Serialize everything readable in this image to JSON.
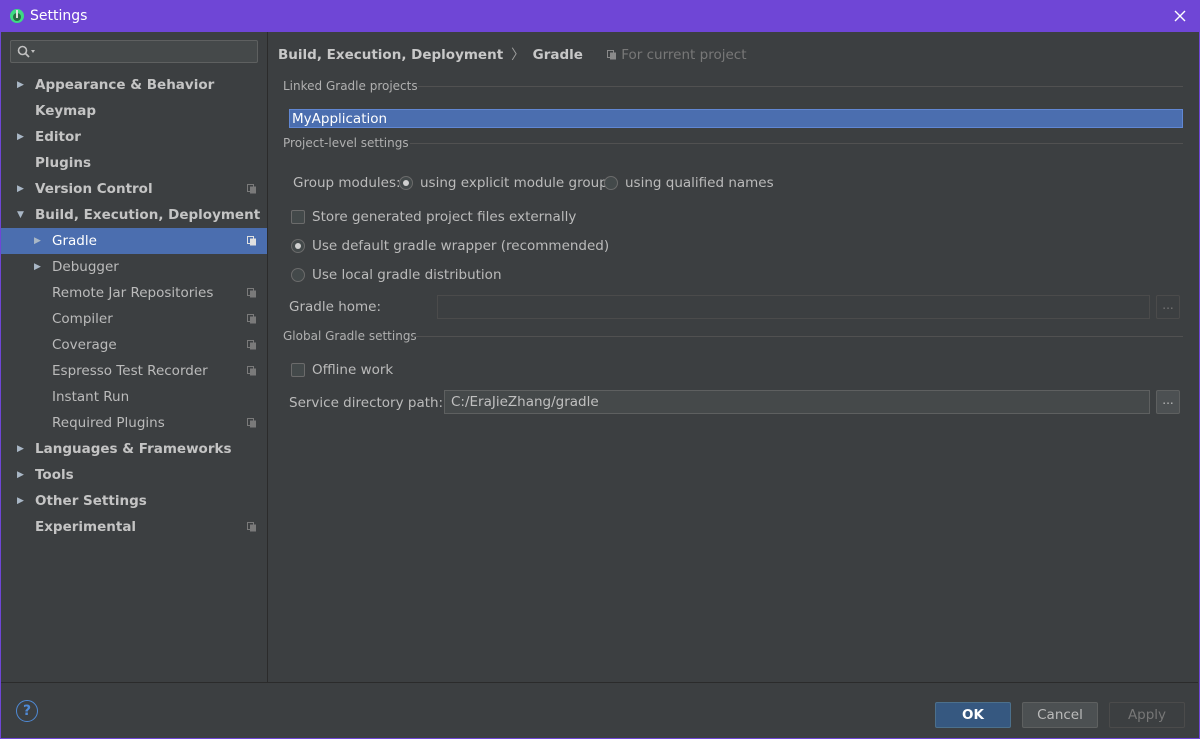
{
  "window": {
    "title": "Settings"
  },
  "search": {
    "placeholder": ""
  },
  "sidebar": {
    "items": [
      {
        "label": "Appearance & Behavior",
        "bold": true,
        "arrow": "▶",
        "level": 0
      },
      {
        "label": "Keymap",
        "bold": true,
        "arrow": "",
        "level": 0
      },
      {
        "label": "Editor",
        "bold": true,
        "arrow": "▶",
        "level": 0
      },
      {
        "label": "Plugins",
        "bold": true,
        "arrow": "",
        "level": 0
      },
      {
        "label": "Version Control",
        "bold": true,
        "arrow": "▶",
        "level": 0,
        "project": true
      },
      {
        "label": "Build, Execution, Deployment",
        "bold": true,
        "arrow": "▼",
        "level": 0
      },
      {
        "label": "Gradle",
        "bold": false,
        "arrow": "▶",
        "level": 1,
        "project": true,
        "selected": true
      },
      {
        "label": "Debugger",
        "bold": false,
        "arrow": "▶",
        "level": 1
      },
      {
        "label": "Remote Jar Repositories",
        "bold": false,
        "arrow": "",
        "level": 1,
        "project": true
      },
      {
        "label": "Compiler",
        "bold": false,
        "arrow": "",
        "level": 1,
        "project": true
      },
      {
        "label": "Coverage",
        "bold": false,
        "arrow": "",
        "level": 1,
        "project": true
      },
      {
        "label": "Espresso Test Recorder",
        "bold": false,
        "arrow": "",
        "level": 1,
        "project": true
      },
      {
        "label": "Instant Run",
        "bold": false,
        "arrow": "",
        "level": 1
      },
      {
        "label": "Required Plugins",
        "bold": false,
        "arrow": "",
        "level": 1,
        "project": true
      },
      {
        "label": "Languages & Frameworks",
        "bold": true,
        "arrow": "▶",
        "level": 0
      },
      {
        "label": "Tools",
        "bold": true,
        "arrow": "▶",
        "level": 0
      },
      {
        "label": "Other Settings",
        "bold": true,
        "arrow": "▶",
        "level": 0
      },
      {
        "label": "Experimental",
        "bold": true,
        "arrow": "",
        "level": 0,
        "project": true
      }
    ]
  },
  "breadcrumb": {
    "parent": "Build, Execution, Deployment",
    "separator": "〉",
    "current": "Gradle",
    "scope": "For current project"
  },
  "linked": {
    "title": "Linked Gradle projects",
    "projects": [
      "MyApplication"
    ]
  },
  "project_level": {
    "title": "Project-level settings",
    "group_modules_label": "Group modules:",
    "group_option_explicit": "using explicit module groups",
    "group_option_qualified": "using qualified names",
    "group_selected": "explicit",
    "store_external_label": "Store generated project files externally",
    "store_external_checked": false,
    "wrapper_label": "Use default gradle wrapper (recommended)",
    "local_label": "Use local gradle distribution",
    "distribution_selected": "wrapper",
    "gradle_home_label": "Gradle home:",
    "gradle_home_value": "",
    "browse_label": "..."
  },
  "global": {
    "title": "Global Gradle settings",
    "offline_label": "Offline work",
    "offline_checked": false,
    "service_dir_label": "Service directory path:",
    "service_dir_value": "C:/EraJieZhang/gradle",
    "browse_label": "..."
  },
  "footer": {
    "help": "?",
    "ok": "OK",
    "cancel": "Cancel",
    "apply": "Apply"
  },
  "colors": {
    "titlebar": "#6f46d6",
    "selection": "#4b6eaf",
    "background": "#3c3f41",
    "default_button": "#365880"
  }
}
